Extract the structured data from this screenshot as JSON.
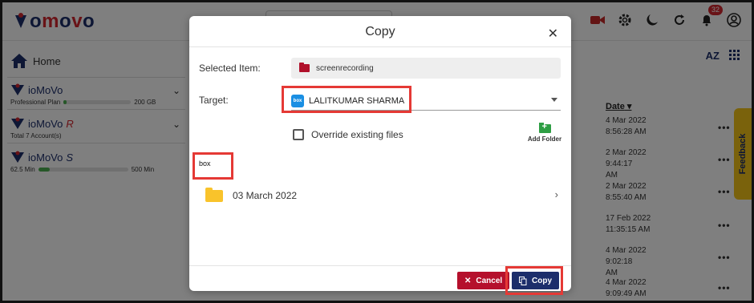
{
  "app": {
    "logo_text": "iomovo",
    "notification_count": "32",
    "icons": [
      "video-icon",
      "gear-icon",
      "night-mode-icon",
      "refresh-icon",
      "bell-icon",
      "account-icon"
    ]
  },
  "sidebar": {
    "home_label": "Home",
    "accounts": [
      {
        "name": "ioMoVo",
        "suffix": "",
        "sub": "Professional Plan",
        "quota": "200 GB",
        "usage": 0.05
      },
      {
        "name": "ioMoVo",
        "suffix": "R",
        "sub": "Total 7 Account(s)"
      },
      {
        "name": "ioMoVo",
        "suffix": "S",
        "sub": "62.5 Min",
        "quota": "500 Min",
        "usage": 0.13
      }
    ]
  },
  "list": {
    "date_header": "Date",
    "dates": [
      "4 Mar 2022\n8:56:28 AM",
      "2 Mar 2022 9:44:17\nAM",
      "2 Mar 2022\n8:55:40 AM",
      "17 Feb 2022\n11:35:15 AM",
      "4 Mar 2022 9:02:18\nAM",
      "4 Mar 2022\n9:09:49 AM"
    ],
    "more_label": "•••",
    "sort_label": "AZ"
  },
  "feedback_label": "Feedback",
  "modal": {
    "title": "Copy",
    "close_label": "✕",
    "selected_item_label": "Selected Item:",
    "selected_item_value": "screenrecording",
    "target_label": "Target:",
    "target_value": "LALITKUMAR SHARMA",
    "target_logo_text": "box",
    "override_label": "Override existing files",
    "add_folder_label": "Add Folder",
    "breadcrumb": "box",
    "folders": [
      {
        "name": "03 March 2022"
      }
    ],
    "cancel_label": "Cancel",
    "copy_label": "Copy"
  },
  "colors": {
    "brand_navy": "#1c2e6b",
    "brand_red": "#b5102c",
    "highlight_red": "#e53935",
    "feedback_yellow": "#f5c518"
  }
}
